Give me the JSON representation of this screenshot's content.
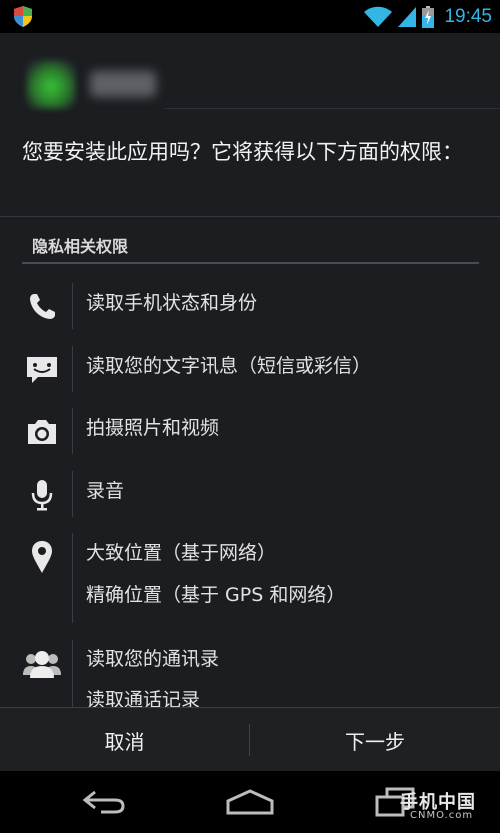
{
  "status_bar": {
    "time": "19:45",
    "icons": [
      "shield-icon",
      "wifi-icon",
      "signal-icon",
      "battery-charging-icon"
    ],
    "accent_color": "#33b5e5"
  },
  "app": {
    "name": "微信"
  },
  "prompt": "您要安装此应用吗？它将获得以下方面的权限：",
  "section": {
    "title": "隐私相关权限"
  },
  "permissions": [
    {
      "icon": "phone-icon",
      "lines": [
        "读取手机状态和身份"
      ]
    },
    {
      "icon": "message-icon",
      "lines": [
        "读取您的文字讯息（短信或彩信）"
      ]
    },
    {
      "icon": "camera-icon",
      "lines": [
        "拍摄照片和视频"
      ]
    },
    {
      "icon": "microphone-icon",
      "lines": [
        "录音"
      ]
    },
    {
      "icon": "location-pin-icon",
      "lines": [
        "大致位置（基于网络）",
        "精确位置（基于 GPS 和网络）"
      ]
    },
    {
      "icon": "contacts-icon",
      "lines": [
        "读取您的通讯录",
        "读取通话记录"
      ]
    }
  ],
  "buttons": {
    "cancel": "取消",
    "next": "下一步"
  },
  "nav": {
    "icons": [
      "back-icon",
      "home-icon",
      "recent-apps-icon"
    ]
  },
  "watermark": {
    "main": "手机中国",
    "sub": "CNMO.com"
  }
}
